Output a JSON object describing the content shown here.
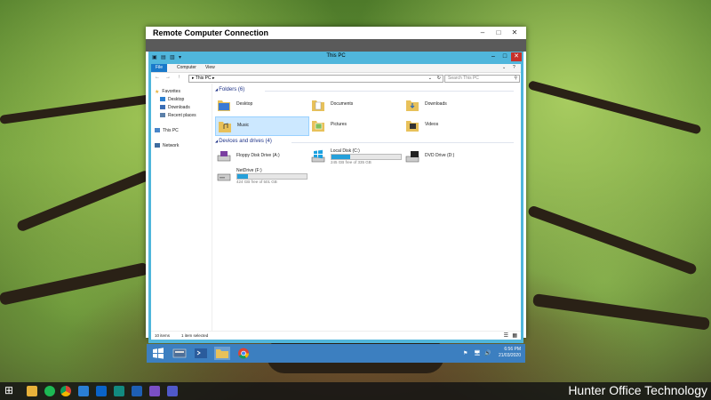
{
  "rdp": {
    "title": "Remote Computer Connection",
    "min": "–",
    "max": "□",
    "close": "✕"
  },
  "explorer": {
    "title": "This PC",
    "quick_access": [
      "▣",
      "▤",
      "▥",
      "▾"
    ],
    "min": "–",
    "max": "□",
    "close": "✕",
    "ribbon": {
      "file": "File",
      "computer": "Computer",
      "view": "View",
      "expand": "⌄",
      "help": "?"
    },
    "nav_buttons": {
      "back": "←",
      "forward": "→",
      "up": "↑"
    },
    "address": "▸ This PC ▸",
    "address_dropdown": "⌄",
    "refresh": "↻",
    "search_placeholder": "Search This PC",
    "nav": {
      "favorites": "Favorites",
      "desktop": "Desktop",
      "downloads": "Downloads",
      "recent": "Recent places",
      "thispc": "This PC",
      "network": "Network"
    },
    "folders_header": "Folders (6)",
    "folders": [
      "Desktop",
      "Documents",
      "Downloads",
      "Music",
      "Pictures",
      "Videos"
    ],
    "drives_header": "Devices and drives (4)",
    "drives": {
      "floppy": {
        "name": "Floppy Disk Drive (A:)"
      },
      "local": {
        "name": "Local Disk (C:)",
        "free": "245 GB free of 335 GB",
        "used_fraction": 0.27
      },
      "dvd": {
        "name": "DVD Drive (D:)"
      },
      "net": {
        "name": "NetDrive (F:)",
        "free": "424 GB free of 501 GB",
        "used_fraction": 0.15
      }
    },
    "status": {
      "items": "10 items",
      "selected": "1 item selected"
    }
  },
  "remote_taskbar": {
    "time": "6:56 PM",
    "date": "21/03/2020",
    "tray": [
      "⚑",
      "🖥",
      "🔊"
    ]
  },
  "local_taskbar": {
    "watermark": "Hunter Office Technology",
    "start": "⊞"
  },
  "colors": {
    "accent": "#1979ca",
    "window_frame": "#50b6dc",
    "remote_taskbar": "#3c7fc0",
    "folder": "#e8c15a"
  }
}
